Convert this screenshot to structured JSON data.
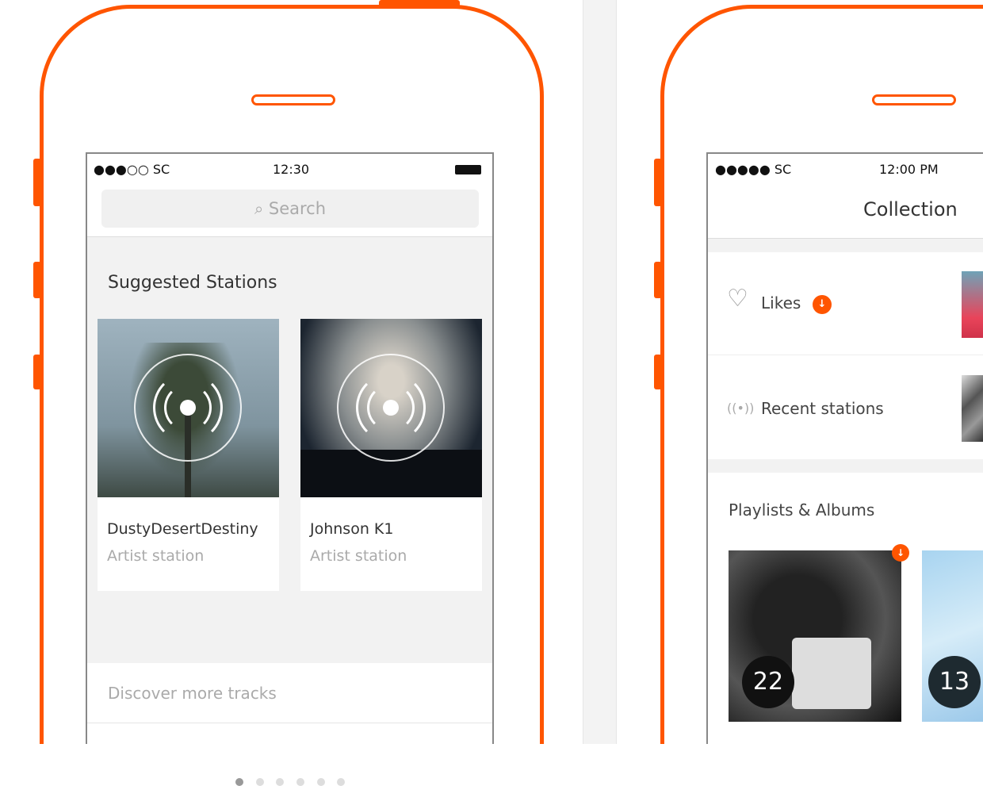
{
  "left_phone": {
    "status": {
      "carrier": "●●●○○ SC",
      "time": "12:30"
    },
    "search": {
      "icon": "search-icon",
      "placeholder": "Search"
    },
    "section_title": "Suggested Stations",
    "stations": [
      {
        "title": "DustyDesertDestiny",
        "subtitle": "Artist station"
      },
      {
        "title": "Johnson K1",
        "subtitle": "Artist station"
      }
    ],
    "pager": {
      "count": 6,
      "active": 1
    },
    "discover": "Discover more tracks"
  },
  "right_phone": {
    "status": {
      "carrier": "●●●●● SC",
      "time": "12:00 PM"
    },
    "header_title": "Collection",
    "rows": [
      {
        "label": "Likes",
        "icon": "heart-icon",
        "download_badge": true
      },
      {
        "label": "Recent stations",
        "icon": "radio-icon"
      }
    ],
    "section_title": "Playlists & Albums",
    "playlists": [
      {
        "count": "22",
        "downloaded": true
      },
      {
        "count": "13"
      }
    ]
  },
  "colors": {
    "accent": "#ff5500"
  }
}
